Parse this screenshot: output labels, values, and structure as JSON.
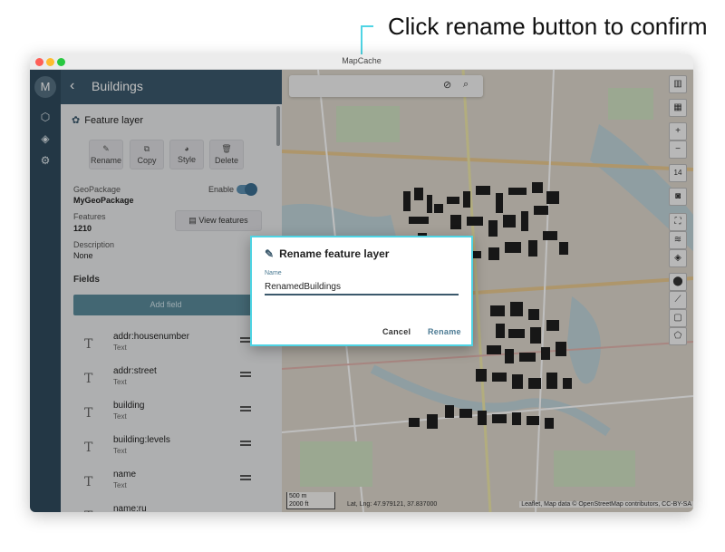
{
  "annotation": "Click rename button to confirm",
  "window": {
    "title": "MapCache"
  },
  "rail": {
    "logo": "M",
    "icons": [
      "cube-icon",
      "layers-icon",
      "gear-icon"
    ]
  },
  "panel": {
    "back_glyph": "‹",
    "title": "Buildings",
    "layer_label": "Feature layer",
    "actions": [
      {
        "icon": "✎",
        "label": "Rename"
      },
      {
        "icon": "⧉",
        "label": "Copy"
      },
      {
        "icon": "◕",
        "label": "Style"
      },
      {
        "icon": "🗑",
        "label": "Delete"
      }
    ],
    "geopackage_label": "GeoPackage",
    "geopackage_value": "MyGeoPackage",
    "enable_label": "Enable",
    "enabled": true,
    "features_label": "Features",
    "features_value": "1210",
    "view_features_label": "View features",
    "description_label": "Description",
    "description_value": "None",
    "fields_title": "Fields",
    "add_field_label": "Add field",
    "fields": [
      {
        "name": "addr:housenumber",
        "type": "Text"
      },
      {
        "name": "addr:street",
        "type": "Text"
      },
      {
        "name": "building",
        "type": "Text"
      },
      {
        "name": "building:levels",
        "type": "Text"
      },
      {
        "name": "name",
        "type": "Text"
      },
      {
        "name": "name:ru",
        "type": ""
      }
    ]
  },
  "map": {
    "zoom_level": "14",
    "scale_metric": "500 m",
    "scale_imperial": "2000 ft",
    "coordinates": "Lat, Lng: 47.979121, 37.837000",
    "attribution": "Leaflet, Map data © OpenStreetMap contributors, CC-BY-SA"
  },
  "dialog": {
    "title": "Rename feature layer",
    "name_label": "Name",
    "name_value": "RenamedBuildings",
    "cancel_label": "Cancel",
    "rename_label": "Rename"
  },
  "colors": {
    "accent": "#4fd4e4",
    "panel_header": "#3b596c",
    "rail": "#2f4a5c",
    "add_field": "#5a8a9a"
  }
}
